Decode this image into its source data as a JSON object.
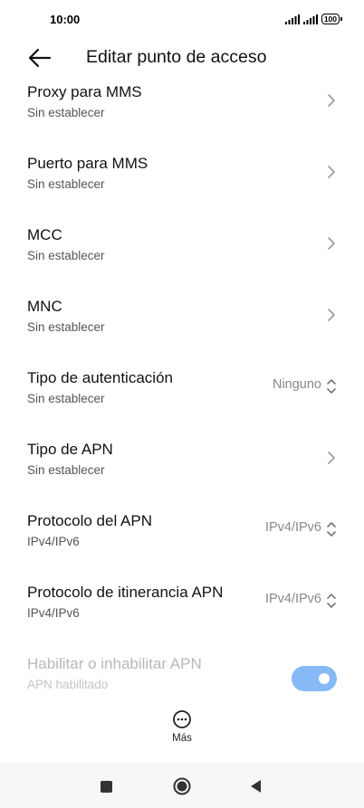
{
  "status_bar": {
    "time": "10:00",
    "battery": "100"
  },
  "header": {
    "title": "Editar punto de acceso"
  },
  "rows": [
    {
      "title": "Proxy para MMS",
      "subtitle": "Sin establecer"
    },
    {
      "title": "Puerto para MMS",
      "subtitle": "Sin establecer"
    },
    {
      "title": "MCC",
      "subtitle": "Sin establecer"
    },
    {
      "title": "MNC",
      "subtitle": "Sin establecer"
    },
    {
      "title": "Tipo de autenticación",
      "subtitle": "Sin establecer",
      "value": "Ninguno"
    },
    {
      "title": "Tipo de APN",
      "subtitle": "Sin establecer"
    },
    {
      "title": "Protocolo del APN",
      "subtitle": "IPv4/IPv6",
      "value": "IPv4/IPv6"
    },
    {
      "title": "Protocolo de itinerancia APN",
      "subtitle": "IPv4/IPv6",
      "value": "IPv4/IPv6"
    },
    {
      "title": "Habilitar o inhabilitar APN",
      "subtitle": "APN habilitado",
      "toggle_on": true,
      "disabled": true
    }
  ],
  "more": {
    "label": "Más"
  },
  "colors": {
    "toggle_on": "#86b9f5",
    "chevron": "#9a9a9a",
    "disabled_text": "#b8b8b8"
  }
}
